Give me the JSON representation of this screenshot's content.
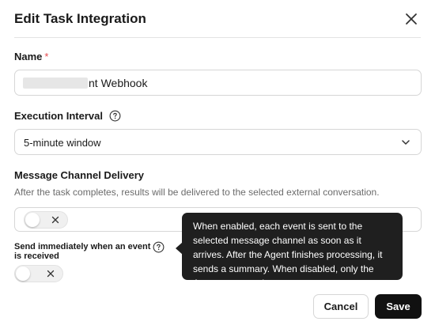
{
  "dialog": {
    "title": "Edit Task Integration",
    "close_icon": "close-icon"
  },
  "name_field": {
    "label": "Name",
    "required_mark": "*",
    "value": "nt Webhook"
  },
  "interval_field": {
    "label": "Execution Interval",
    "help_icon": "question-circle-icon",
    "selected": "5-minute window",
    "chevron_icon": "chevron-down-icon"
  },
  "channel_section": {
    "label": "Message Channel Delivery",
    "description": "After the task completes, results will be delivered to the selected external conversation.",
    "toggle_state": "off"
  },
  "send_immediately": {
    "label": "Send immediately when an event is received",
    "help_icon": "question-circle-icon",
    "toggle_state": "off"
  },
  "tooltip": {
    "text": "When enabled, each event is sent to the selected message channel as soon as it arrives. After the Agent finishes processing, it sends a summary. When disabled, only the Agent summary is sent."
  },
  "footer": {
    "cancel_label": "Cancel",
    "save_label": "Save"
  },
  "colors": {
    "required": "#e5484d",
    "primary_button": "#111111",
    "tooltip_bg": "#1f1f1f",
    "border": "#d6d6d6"
  }
}
